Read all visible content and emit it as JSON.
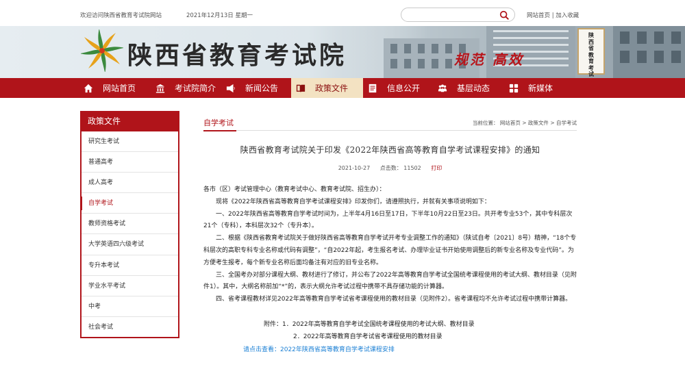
{
  "topbar": {
    "welcome": "欢迎访问陕西省教育考试院网站",
    "date": "2021年12月13日  星期一",
    "search_placeholder": "",
    "links": "网站首页 | 加入收藏"
  },
  "banner": {
    "title": "陕西省教育考试院",
    "slogan": "规范 高效",
    "plaque_lines": [
      "陕",
      "西",
      "省",
      "教",
      "育",
      "考",
      "试",
      "院"
    ]
  },
  "nav": {
    "items": [
      {
        "label": "网站首页",
        "icon": "home-icon"
      },
      {
        "label": "考试院简介",
        "icon": "building-icon"
      },
      {
        "label": "新闻公告",
        "icon": "news-icon"
      },
      {
        "label": "政策文件",
        "icon": "book-icon",
        "active": true
      },
      {
        "label": "信息公开",
        "icon": "document-icon"
      },
      {
        "label": "基层动态",
        "icon": "people-icon"
      },
      {
        "label": "新媒体",
        "icon": "grid-icon"
      }
    ]
  },
  "sidebar": {
    "title": "政策文件",
    "items": [
      {
        "label": "研究生考试"
      },
      {
        "label": "普通高考"
      },
      {
        "label": "成人高考"
      },
      {
        "label": "自学考试",
        "active": true
      },
      {
        "label": "教师资格考试"
      },
      {
        "label": "大学英语四六级考试"
      },
      {
        "label": "专升本考试"
      },
      {
        "label": "学业水平考试"
      },
      {
        "label": "中考"
      },
      {
        "label": "社会考试"
      }
    ]
  },
  "main": {
    "category": "自学考试",
    "breadcrumb": "当前位置：  网站首页  >  政策文件  >  自学考试",
    "title": "陕西省教育考试院关于印发《2022年陕西省高等教育自学考试课程安排》的通知",
    "date": "2021-10-27",
    "clicks": "点击数：  11502",
    "print": "打印",
    "paragraphs": [
      "各市（区）考试管理中心（教育考试中心、教育考试院、招生办）：",
      "现将《2022年陕西省高等教育自学考试课程安排》印发你们，请遵照执行，并就有关事项说明如下：",
      "一、2022年陕西省高等教育自学考试时间为，上半年4月16日至17日，下半年10月22日至23日。共开考专业53个，其中专科层次21个（专科），本科层次32个（专升本）。",
      "二、根据《陕西省教育考试院关于做好陕西省高等教育自学考试开考专业调整工作的通知》（陕试自考〔2021〕8号）精神，“18个专科层次的高职专科专业名称或代码有调整”，“自2022年起，考生报名考试、办理毕业证书开始使用调整后的新专业名称及专业代码”。为方便考生报考，每个新专业名称后面均备注有对应的旧专业名称。",
      "三、全国考办对部分课程大纲、教材进行了修订，并公布了2022年高等教育自学考试全国统考课程使用的考试大纲、教材目录（见附件1）。其中，大纲名称前加“*”的，表示大纲允许考试过程中携带不具存储功能的计算器。",
      "四、省考课程教材详见2022年高等教育自学考试省考课程使用的教材目录（见附件2）。省考课程均不允许考试过程中携带计算器。"
    ],
    "attachment_1": "附件：1．2022年高等教育自学考试全国统考课程使用的考试大纲、教材目录",
    "attachment_2": "2．2022年高等教育自学考试省考课程使用的教材目录",
    "view_link": "请点击查看：2022年陕西省高等教育自学考试课程安排"
  },
  "colors": {
    "brand_red": "#b0141a",
    "active_nav_bg": "#f3e2c2",
    "link_blue": "#1a7fd4"
  }
}
